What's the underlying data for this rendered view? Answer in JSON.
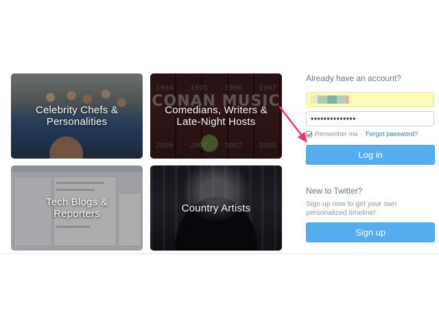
{
  "tiles": [
    {
      "label_line1": "Celebrity Chefs &",
      "label_line2": "Personalities"
    },
    {
      "label_line1": "Comedians, Writers &",
      "label_line2": "Late-Night Hosts",
      "bg_text": "CONAN MUSIC",
      "bg_years_top": [
        "1994",
        "1995",
        "1996",
        "1997"
      ],
      "bg_years_bottom": [
        "2006",
        "2007",
        "2007",
        "2008"
      ]
    },
    {
      "label_line1": "Tech Blogs &",
      "label_line2": "Reporters"
    },
    {
      "label_line1": "Country Artists",
      "label_line2": ""
    }
  ],
  "signin": {
    "title": "Already have an account?",
    "password_value": "••••••••••••••",
    "remember_label": "Remember me",
    "separator": "·",
    "forgot_label": "Forgot password?",
    "login_label": "Log in"
  },
  "signup": {
    "title": "New to Twitter?",
    "description": "Sign up now to get your own personalized timeline!",
    "button_label": "Sign up"
  },
  "colors": {
    "accent": "#55acee",
    "annotation_arrow": "#e8336f",
    "autofill": "#fbfbb5"
  }
}
